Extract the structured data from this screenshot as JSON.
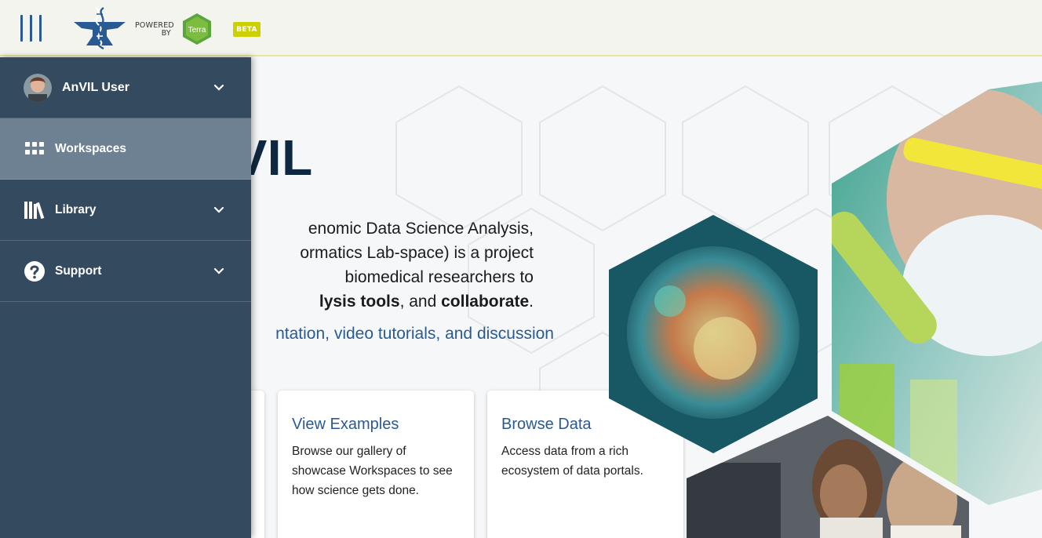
{
  "header": {
    "menu_icon": "hamburger-icon",
    "logo_icon": "anvil-logo",
    "powered_line1": "POWERED",
    "powered_line2": "BY",
    "terra_label": "Terra",
    "beta_badge": "BETA"
  },
  "sidebar": {
    "user": {
      "name": "AnVIL User",
      "avatar_icon": "user-avatar"
    },
    "items": [
      {
        "label": "Workspaces",
        "icon": "grid-icon",
        "active": true
      },
      {
        "label": "Library",
        "icon": "library-icon",
        "expandable": true
      },
      {
        "label": "Support",
        "icon": "question-icon",
        "expandable": true
      }
    ]
  },
  "main": {
    "welcome_title": "ne to AnVIL",
    "intro": {
      "line1": "enomic Data Science Analysis,",
      "line2": "ormatics Lab-space) is a project",
      "line3": "biomedical researchers to",
      "line4_bold": "lysis tools",
      "line4_mid": ", and ",
      "line4_bold2": "collaborate",
      "line4_end": "."
    },
    "learn_link": "ntation, video tutorials, and discussion",
    "cards": [
      {
        "title": "View Examples",
        "body": "Browse our gallery of showcase Workspaces to see how science gets done."
      },
      {
        "title": "Browse Data",
        "body": "Access data from a rich ecosystem of data portals."
      }
    ]
  },
  "colors": {
    "sidebar_bg": "#334a5f",
    "sidebar_active": "#6d8193",
    "accent_blue": "#2a5a93",
    "beta_yellow": "#cdd000",
    "terra_green": "#5aa63c"
  }
}
